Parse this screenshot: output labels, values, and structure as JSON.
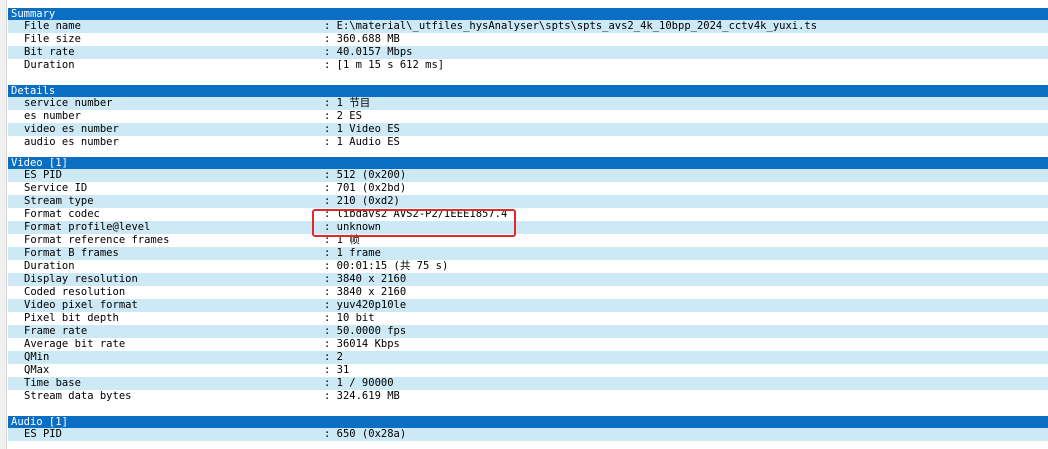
{
  "sections": [
    {
      "title": "Summary",
      "rows": [
        {
          "key": "File name",
          "value": ": E:\\material\\_utfiles_hysAnalyser\\spts\\spts_avs2_4k_10bpp_2024_cctv4k_yuxi.ts"
        },
        {
          "key": "File size",
          "value": ": 360.688 MB"
        },
        {
          "key": "Bit rate",
          "value": ": 40.0157 Mbps"
        },
        {
          "key": "Duration",
          "value": ": [1 m 15 s 612 ms]"
        }
      ]
    },
    {
      "title": "Details",
      "rows": [
        {
          "key": "service number",
          "value": ": 1 节目"
        },
        {
          "key": "es number",
          "value": ": 2 ES"
        },
        {
          "key": "video es number",
          "value": ": 1 Video ES"
        },
        {
          "key": "audio es number",
          "value": ": 1 Audio ES"
        }
      ]
    },
    {
      "title": "Video [1]",
      "rows": [
        {
          "key": "ES PID",
          "value": ": 512 (0x200)"
        },
        {
          "key": "Service ID",
          "value": ": 701 (0x2bd)"
        },
        {
          "key": "Stream type",
          "value": ": 210 (0xd2)"
        },
        {
          "key": "Format codec",
          "value": ": libdavs2 AVS2-P2/IEEE1857.4"
        },
        {
          "key": "Format profile@level",
          "value": ": unknown"
        },
        {
          "key": "Format reference frames",
          "value": ": 1 帧"
        },
        {
          "key": "Format B frames",
          "value": ": 1 frame"
        },
        {
          "key": "Duration",
          "value": ": 00:01:15 (共 75 s)"
        },
        {
          "key": "Display resolution",
          "value": ": 3840 x 2160"
        },
        {
          "key": "Coded resolution",
          "value": ": 3840 x 2160"
        },
        {
          "key": "Video pixel format",
          "value": ": yuv420p10le"
        },
        {
          "key": "Pixel bit depth",
          "value": ": 10 bit"
        },
        {
          "key": "Frame rate",
          "value": ": 50.0000 fps"
        },
        {
          "key": "Average bit rate",
          "value": ": 36014 Kbps"
        },
        {
          "key": "QMin",
          "value": ": 2"
        },
        {
          "key": "QMax",
          "value": ": 31"
        },
        {
          "key": "Time base",
          "value": ": 1 / 90000"
        },
        {
          "key": "Stream data bytes",
          "value": ": 324.619 MB"
        }
      ]
    },
    {
      "title": "Audio [1]",
      "rows": [
        {
          "key": "ES PID",
          "value": ": 650 (0x28a)"
        }
      ]
    }
  ],
  "colors": {
    "header": "#0a6fc2",
    "row_stripe": "#cce9f5",
    "highlight": "#e02a2a"
  }
}
